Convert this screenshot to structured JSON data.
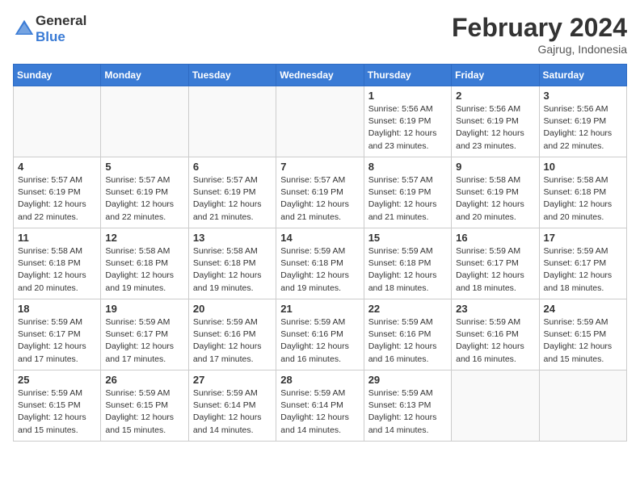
{
  "header": {
    "logo_general": "General",
    "logo_blue": "Blue",
    "month_year": "February 2024",
    "location": "Gajrug, Indonesia"
  },
  "days_of_week": [
    "Sunday",
    "Monday",
    "Tuesday",
    "Wednesday",
    "Thursday",
    "Friday",
    "Saturday"
  ],
  "weeks": [
    [
      {
        "day": "",
        "info": ""
      },
      {
        "day": "",
        "info": ""
      },
      {
        "day": "",
        "info": ""
      },
      {
        "day": "",
        "info": ""
      },
      {
        "day": "1",
        "info": "Sunrise: 5:56 AM\nSunset: 6:19 PM\nDaylight: 12 hours\nand 23 minutes."
      },
      {
        "day": "2",
        "info": "Sunrise: 5:56 AM\nSunset: 6:19 PM\nDaylight: 12 hours\nand 23 minutes."
      },
      {
        "day": "3",
        "info": "Sunrise: 5:56 AM\nSunset: 6:19 PM\nDaylight: 12 hours\nand 22 minutes."
      }
    ],
    [
      {
        "day": "4",
        "info": "Sunrise: 5:57 AM\nSunset: 6:19 PM\nDaylight: 12 hours\nand 22 minutes."
      },
      {
        "day": "5",
        "info": "Sunrise: 5:57 AM\nSunset: 6:19 PM\nDaylight: 12 hours\nand 22 minutes."
      },
      {
        "day": "6",
        "info": "Sunrise: 5:57 AM\nSunset: 6:19 PM\nDaylight: 12 hours\nand 21 minutes."
      },
      {
        "day": "7",
        "info": "Sunrise: 5:57 AM\nSunset: 6:19 PM\nDaylight: 12 hours\nand 21 minutes."
      },
      {
        "day": "8",
        "info": "Sunrise: 5:57 AM\nSunset: 6:19 PM\nDaylight: 12 hours\nand 21 minutes."
      },
      {
        "day": "9",
        "info": "Sunrise: 5:58 AM\nSunset: 6:19 PM\nDaylight: 12 hours\nand 20 minutes."
      },
      {
        "day": "10",
        "info": "Sunrise: 5:58 AM\nSunset: 6:18 PM\nDaylight: 12 hours\nand 20 minutes."
      }
    ],
    [
      {
        "day": "11",
        "info": "Sunrise: 5:58 AM\nSunset: 6:18 PM\nDaylight: 12 hours\nand 20 minutes."
      },
      {
        "day": "12",
        "info": "Sunrise: 5:58 AM\nSunset: 6:18 PM\nDaylight: 12 hours\nand 19 minutes."
      },
      {
        "day": "13",
        "info": "Sunrise: 5:58 AM\nSunset: 6:18 PM\nDaylight: 12 hours\nand 19 minutes."
      },
      {
        "day": "14",
        "info": "Sunrise: 5:59 AM\nSunset: 6:18 PM\nDaylight: 12 hours\nand 19 minutes."
      },
      {
        "day": "15",
        "info": "Sunrise: 5:59 AM\nSunset: 6:18 PM\nDaylight: 12 hours\nand 18 minutes."
      },
      {
        "day": "16",
        "info": "Sunrise: 5:59 AM\nSunset: 6:17 PM\nDaylight: 12 hours\nand 18 minutes."
      },
      {
        "day": "17",
        "info": "Sunrise: 5:59 AM\nSunset: 6:17 PM\nDaylight: 12 hours\nand 18 minutes."
      }
    ],
    [
      {
        "day": "18",
        "info": "Sunrise: 5:59 AM\nSunset: 6:17 PM\nDaylight: 12 hours\nand 17 minutes."
      },
      {
        "day": "19",
        "info": "Sunrise: 5:59 AM\nSunset: 6:17 PM\nDaylight: 12 hours\nand 17 minutes."
      },
      {
        "day": "20",
        "info": "Sunrise: 5:59 AM\nSunset: 6:16 PM\nDaylight: 12 hours\nand 17 minutes."
      },
      {
        "day": "21",
        "info": "Sunrise: 5:59 AM\nSunset: 6:16 PM\nDaylight: 12 hours\nand 16 minutes."
      },
      {
        "day": "22",
        "info": "Sunrise: 5:59 AM\nSunset: 6:16 PM\nDaylight: 12 hours\nand 16 minutes."
      },
      {
        "day": "23",
        "info": "Sunrise: 5:59 AM\nSunset: 6:16 PM\nDaylight: 12 hours\nand 16 minutes."
      },
      {
        "day": "24",
        "info": "Sunrise: 5:59 AM\nSunset: 6:15 PM\nDaylight: 12 hours\nand 15 minutes."
      }
    ],
    [
      {
        "day": "25",
        "info": "Sunrise: 5:59 AM\nSunset: 6:15 PM\nDaylight: 12 hours\nand 15 minutes."
      },
      {
        "day": "26",
        "info": "Sunrise: 5:59 AM\nSunset: 6:15 PM\nDaylight: 12 hours\nand 15 minutes."
      },
      {
        "day": "27",
        "info": "Sunrise: 5:59 AM\nSunset: 6:14 PM\nDaylight: 12 hours\nand 14 minutes."
      },
      {
        "day": "28",
        "info": "Sunrise: 5:59 AM\nSunset: 6:14 PM\nDaylight: 12 hours\nand 14 minutes."
      },
      {
        "day": "29",
        "info": "Sunrise: 5:59 AM\nSunset: 6:13 PM\nDaylight: 12 hours\nand 14 minutes."
      },
      {
        "day": "",
        "info": ""
      },
      {
        "day": "",
        "info": ""
      }
    ]
  ]
}
